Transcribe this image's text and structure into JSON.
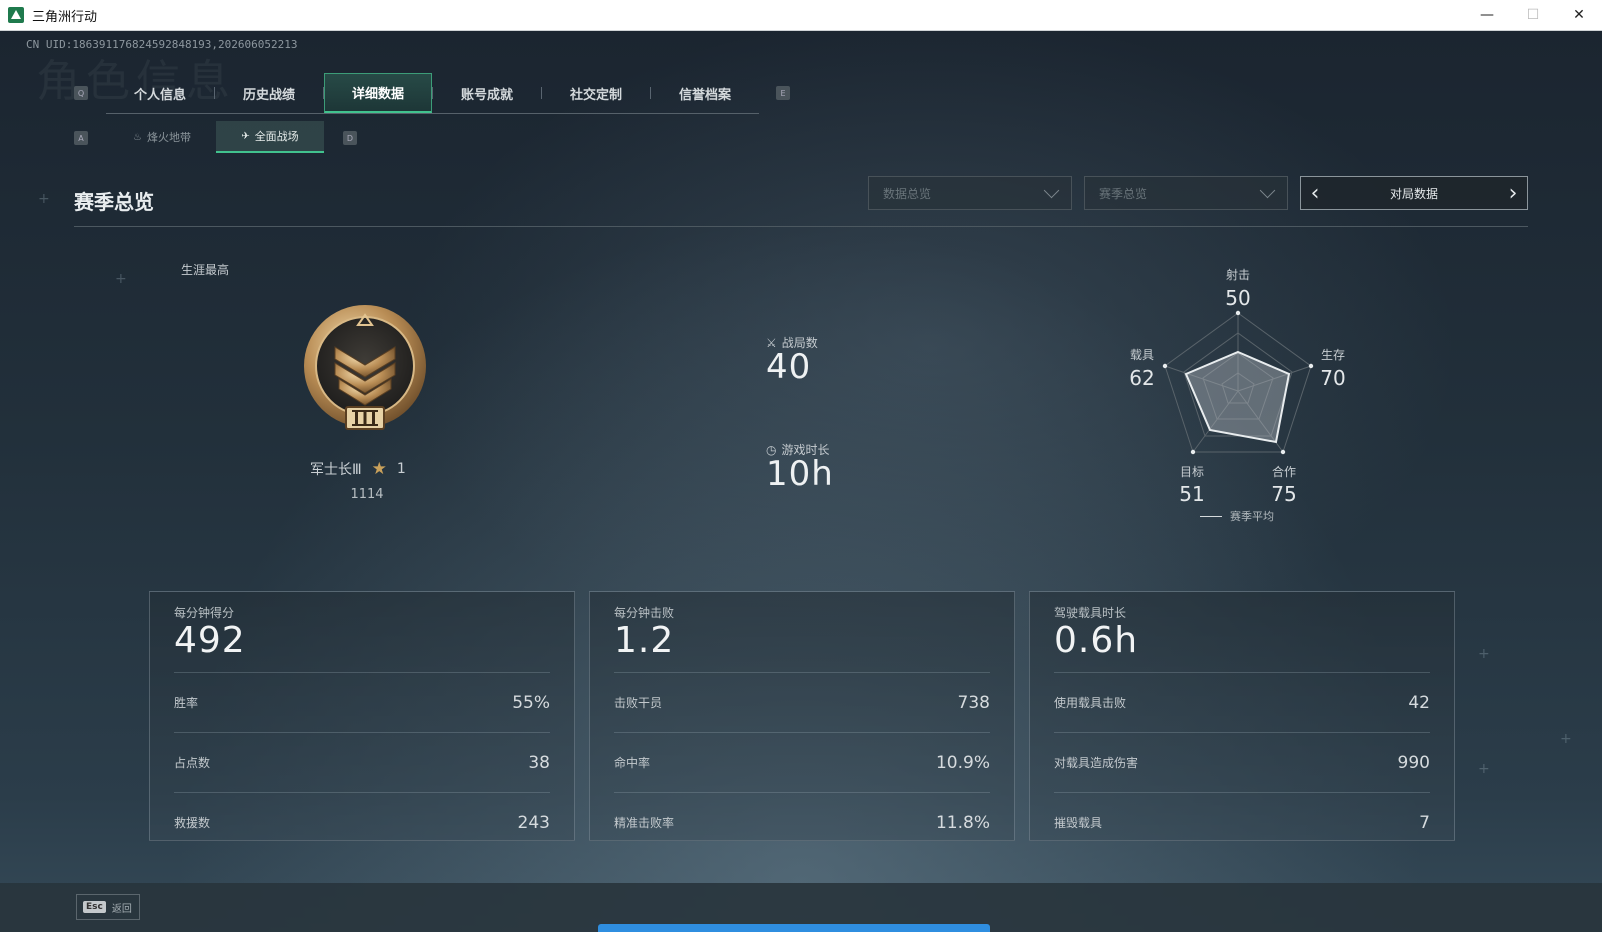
{
  "window": {
    "title": "三角洲行动",
    "minimize": "—",
    "maximize": "☐",
    "close": "✕"
  },
  "uid": "CN UID:18639117682459284819​3,202606052213",
  "watermark": "角色信息",
  "keyhints": {
    "tab_left": "Q",
    "tab_right": "E",
    "sub_left": "A",
    "sub_right": "D"
  },
  "tabs": [
    {
      "label": "个人信息"
    },
    {
      "label": "历史战绩"
    },
    {
      "label": "详细数据",
      "active": true
    },
    {
      "label": "账号成就"
    },
    {
      "label": "社交定制"
    },
    {
      "label": "信誉档案"
    }
  ],
  "subtabs": [
    {
      "label": "烽火地带",
      "icon": "flame-icon"
    },
    {
      "label": "全面战场",
      "icon": "aircraft-icon",
      "active": true
    }
  ],
  "section": {
    "title": "赛季总览",
    "dropdown1": "数据总览",
    "dropdown2": "赛季总览",
    "stepper": "对局数据"
  },
  "rank": {
    "career_label": "生涯最高",
    "name": "军士长Ⅲ",
    "stars": "1",
    "score": "1114"
  },
  "stats": {
    "matches_label": "战局数",
    "matches_value": "40",
    "playtime_label": "游戏时长",
    "playtime_value": "10h"
  },
  "radar": {
    "axes": [
      {
        "label": "射击",
        "value": "50"
      },
      {
        "label": "生存",
        "value": "70"
      },
      {
        "label": "合作",
        "value": "75"
      },
      {
        "label": "目标",
        "value": "51"
      },
      {
        "label": "载具",
        "value": "62"
      }
    ],
    "legend": "赛季平均"
  },
  "cards": [
    {
      "label": "每分钟得分",
      "value": "492",
      "rows": [
        {
          "k": "胜率",
          "v": "55%"
        },
        {
          "k": "占点数",
          "v": "38"
        },
        {
          "k": "救援数",
          "v": "243"
        }
      ]
    },
    {
      "label": "每分钟击败",
      "value": "1.2",
      "rows": [
        {
          "k": "击败干员",
          "v": "738"
        },
        {
          "k": "命中率",
          "v": "10.9%"
        },
        {
          "k": "精准击败率",
          "v": "11.8%"
        }
      ]
    },
    {
      "label": "驾驶载具时长",
      "value": "0.6h",
      "rows": [
        {
          "k": "使用载具击败",
          "v": "42"
        },
        {
          "k": "对载具造成伤害",
          "v": "990"
        },
        {
          "k": "摧毁载具",
          "v": "7"
        }
      ]
    }
  ],
  "footer": {
    "esc_key": "Esc",
    "esc_label": "返回"
  },
  "colors": {
    "accent": "#41c28e",
    "progress": "#2f8ee0"
  }
}
